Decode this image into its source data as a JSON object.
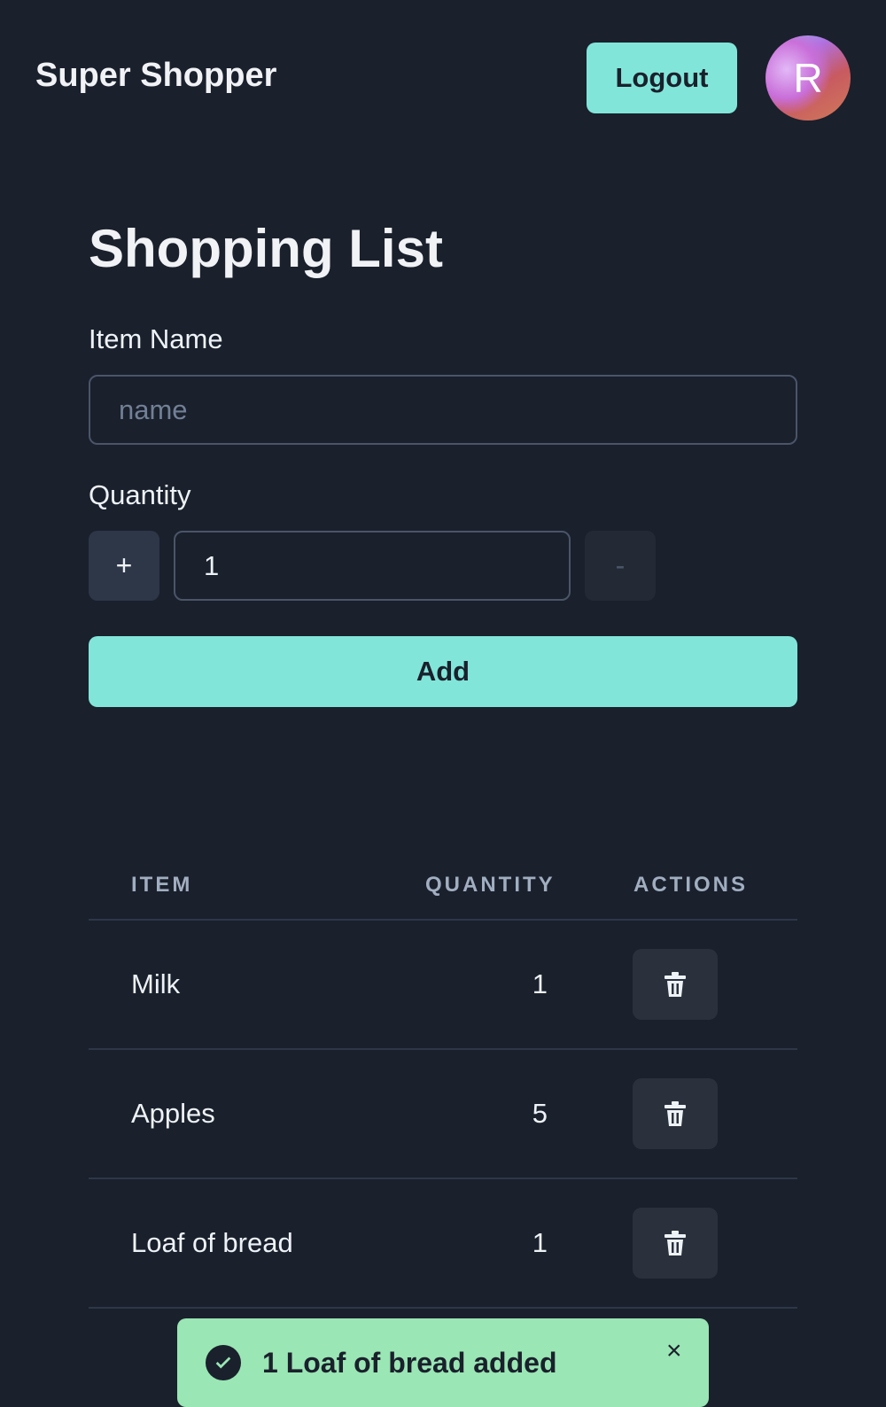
{
  "header": {
    "brand": "Super Shopper",
    "logout_label": "Logout",
    "avatar_initial": "R"
  },
  "form": {
    "title": "Shopping List",
    "item_label": "Item Name",
    "item_placeholder": "name",
    "item_value": "",
    "quantity_label": "Quantity",
    "plus_label": "+",
    "quantity_value": "1",
    "minus_label": "-",
    "add_label": "Add"
  },
  "table": {
    "headers": [
      "ITEM",
      "QUANTITY",
      "ACTIONS"
    ],
    "rows": [
      {
        "item": "Milk",
        "quantity": "1"
      },
      {
        "item": "Apples",
        "quantity": "5"
      },
      {
        "item": "Loaf of bread",
        "quantity": "1"
      }
    ]
  },
  "toast": {
    "message": "1 Loaf of bread added",
    "close": "×"
  },
  "colors": {
    "accent": "#81e6d9",
    "background": "#1a202c",
    "toast": "#9ae6b4"
  }
}
